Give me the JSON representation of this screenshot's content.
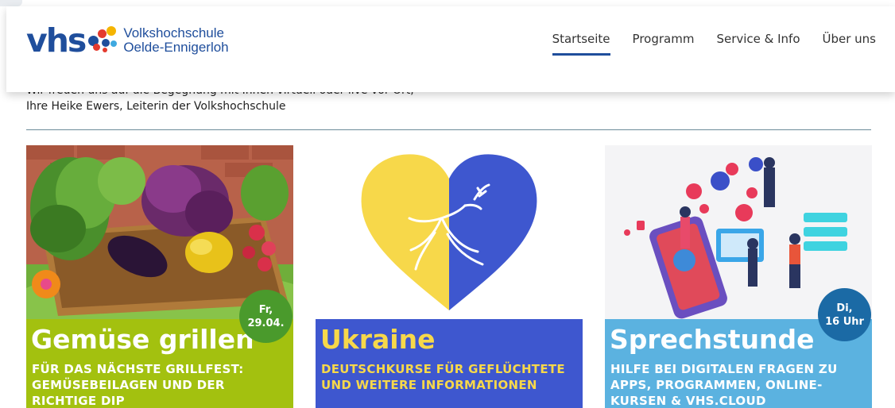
{
  "header": {
    "logo_mark": "vhs",
    "logo_line1": "Volkshochschule",
    "logo_line2": "Oelde-Ennigerloh",
    "nav": [
      "Startseite",
      "Programm",
      "Service & Info",
      "Über uns"
    ],
    "active_nav": "Startseite"
  },
  "intro": {
    "line1": "Wir freuen uns auf die Begegnung mit Ihnen virtuell oder live vor Ort,",
    "line2": "Ihre Heike Ewers, Leiterin der Volkshochschule"
  },
  "cards": [
    {
      "title": "Gemüse grillen",
      "subtitle": "FÜR DAS NÄCHSTE GRILLFEST: GEMÜSEBEILAGEN UND DER RICHTIGE DIP",
      "badge_line1": "Fr,",
      "badge_line2": "29.04.",
      "panel_color": "#a3c10f",
      "badge_color": "#4a9a2c",
      "text_color": "#ffffff"
    },
    {
      "title": "Ukraine",
      "subtitle": "DEUTSCHKURSE FÜR GEFLÜCHTETE UND WEITERE INFORMATIONEN",
      "panel_color": "#3e57cf",
      "text_color": "#f7d84a"
    },
    {
      "title": "Sprechstunde",
      "subtitle": "HILFE BEI DIGITALEN FRAGEN ZU APPS, PROGRAMMEN, ONLINE-KURSEN & VHS.CLOUD",
      "badge_line1": "Di,",
      "badge_line2": "16 Uhr",
      "panel_color": "#5bb2e0",
      "badge_color": "#1b6aa5",
      "text_color": "#ffffff"
    }
  ],
  "colors": {
    "brand_blue": "#1f4e9c",
    "ukraine_yellow": "#f7d84a",
    "ukraine_blue": "#3e57cf"
  },
  "icons": [
    "dove-icon",
    "heart-icon",
    "vegetables-image",
    "digital-illustration"
  ]
}
